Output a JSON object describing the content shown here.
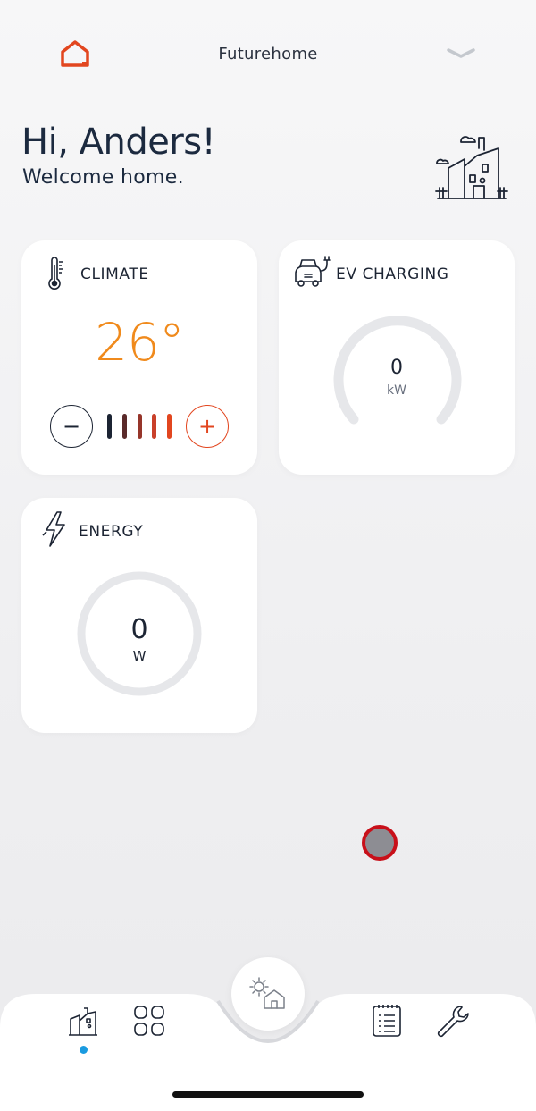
{
  "header": {
    "app_title": "Futurehome",
    "logo_icon": "futurehome-logo-icon",
    "menu_icon": "chevron-down-icon",
    "accent_color": "#e2461f"
  },
  "greeting": {
    "title": "Hi, Anders!",
    "subtitle": "Welcome home."
  },
  "cards": {
    "climate": {
      "title": "CLIMATE",
      "icon": "thermometer-icon",
      "temperature": "26°",
      "minus_label": "−",
      "plus_label": "+",
      "bar_colors": [
        "#1c2433",
        "#5a2a2a",
        "#96352a",
        "#c9402a",
        "#e2461f"
      ],
      "temp_color": "#f08a1c"
    },
    "ev_charging": {
      "title": "EV CHARGING",
      "icon": "ev-car-plug-icon",
      "value": "0",
      "unit": "kW"
    },
    "energy": {
      "title": "ENERGY",
      "icon": "lightning-icon",
      "value": "0",
      "unit": "W"
    }
  },
  "navbar": {
    "items": [
      {
        "icon": "house-icon",
        "active": true
      },
      {
        "icon": "rooms-grid-icon",
        "active": false
      },
      {
        "icon": "sun-house-icon",
        "active": false
      },
      {
        "icon": "log-list-icon",
        "active": false
      },
      {
        "icon": "wrench-icon",
        "active": false
      }
    ],
    "active_color": "#1a9be0"
  }
}
